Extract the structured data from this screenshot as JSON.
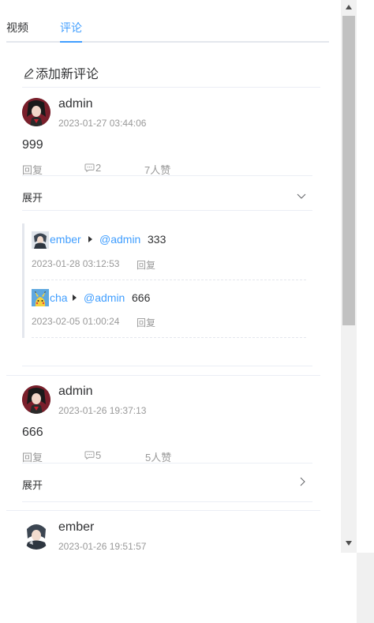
{
  "tabs": [
    {
      "label": "视频",
      "active": false
    },
    {
      "label": "评论",
      "active": true
    }
  ],
  "add_comment_label": "添加新评论",
  "comments": [
    {
      "user": "admin",
      "time": "2023-01-27 03:44:06",
      "content": "999",
      "reply_label": "回复",
      "reply_count": "2",
      "likes": "7人赞",
      "expand_label": "展开",
      "expanded": true,
      "replies": [
        {
          "user": "ember",
          "target": "@admin",
          "text": "333",
          "time": "2023-01-28 03:12:53",
          "reply_label": "回复"
        },
        {
          "user": "cha",
          "target": "@admin",
          "text": "666",
          "time": "2023-02-05 01:00:24",
          "reply_label": "回复"
        }
      ]
    },
    {
      "user": "admin",
      "time": "2023-01-26 19:37:13",
      "content": "666",
      "reply_label": "回复",
      "reply_count": "5",
      "likes": "5人赞",
      "expand_label": "展开",
      "expanded": false
    },
    {
      "user": "ember",
      "time": "2023-01-26 19:51:57"
    }
  ],
  "colors": {
    "accent": "#409eff",
    "muted": "#999999",
    "text": "#303133"
  }
}
